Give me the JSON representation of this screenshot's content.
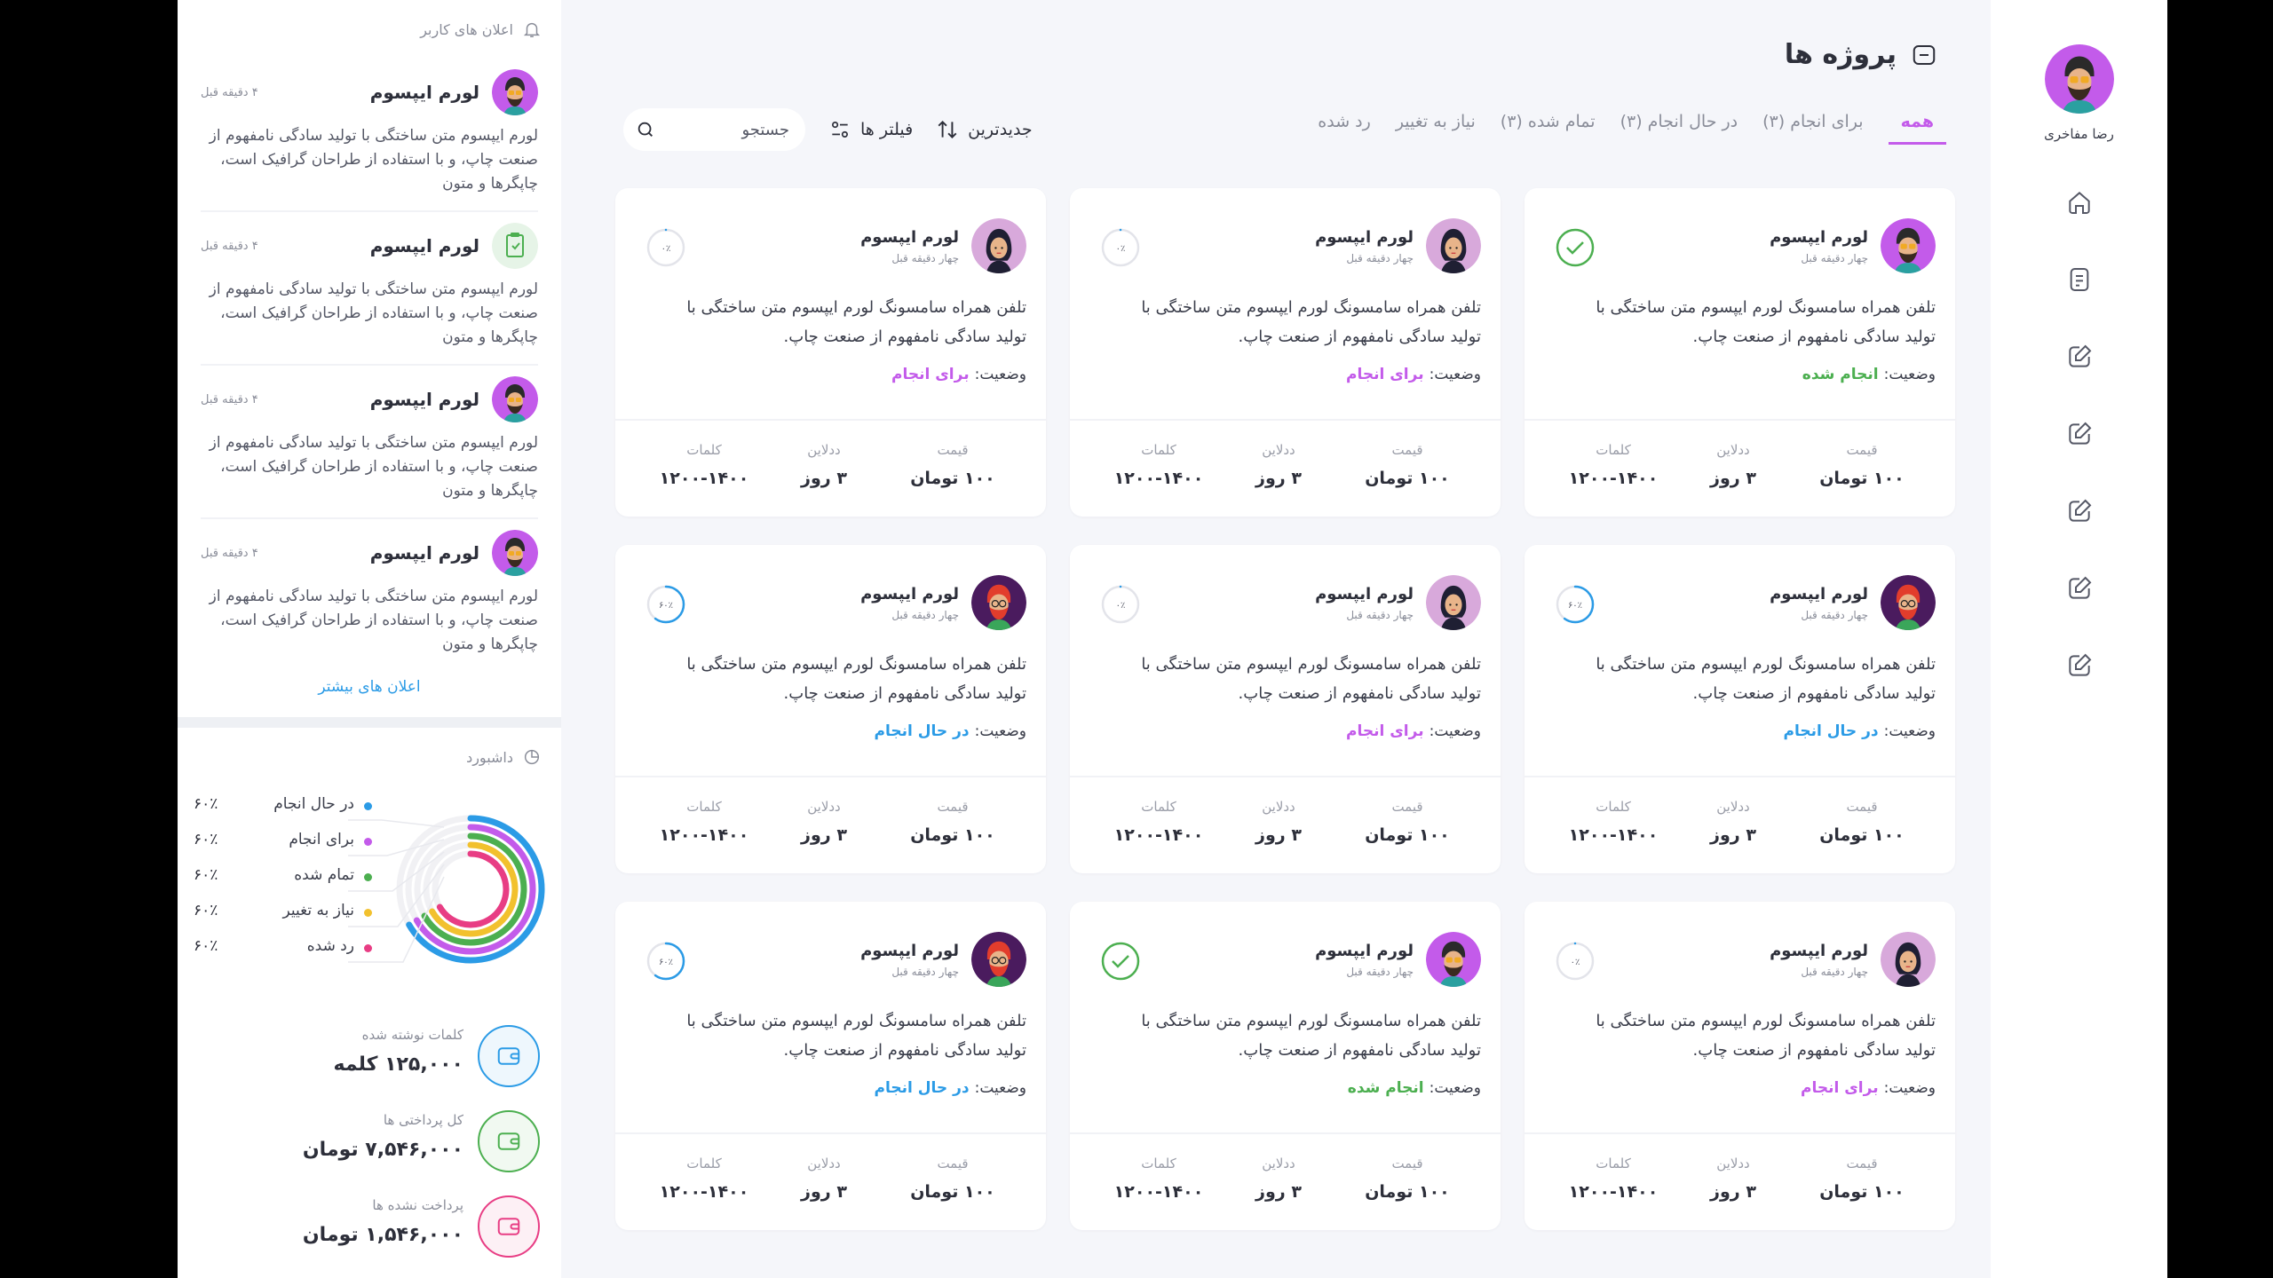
{
  "user": {
    "name": "رضا مفاخری"
  },
  "nav_icons": [
    "home-icon",
    "document-icon",
    "edit-icon",
    "edit-icon",
    "edit-icon",
    "edit-icon",
    "edit-icon"
  ],
  "page": {
    "title": "پروژه ها"
  },
  "tabs": [
    {
      "label": "همه",
      "active": true
    },
    {
      "label": "برای انجام (۳)"
    },
    {
      "label": "در حال انجام (۳)"
    },
    {
      "label": "تمام شده (۳)"
    },
    {
      "label": "نیاز به تغییر"
    },
    {
      "label": "رد شده"
    }
  ],
  "tools": {
    "sort": "جدیدترین",
    "filters": "فیلتر ها",
    "search_placeholder": "جستجو"
  },
  "notifications": {
    "title": "اعلان های کاربر",
    "items": [
      {
        "title": "لورم ایپسوم",
        "time": "۴ دقیقه قبل",
        "text": "لورم ایپسوم متن ساختگی با تولید سادگی نامفهوم از صنعت چاپ، و با استفاده از طراحان گرافیک است، چاپگرها و متون",
        "avatar": "man"
      },
      {
        "title": "لورم ایپسوم",
        "time": "۴ دقیقه قبل",
        "text": "لورم ایپسوم متن ساختگی با تولید سادگی نامفهوم از صنعت چاپ، و با استفاده از طراحان گرافیک است، چاپگرها و متون",
        "avatar": "clipboard"
      },
      {
        "title": "لورم ایپسوم",
        "time": "۴ دقیقه قبل",
        "text": "لورم ایپسوم متن ساختگی با تولید سادگی نامفهوم از صنعت چاپ، و با استفاده از طراحان گرافیک است، چاپگرها و متون",
        "avatar": "man"
      },
      {
        "title": "لورم ایپسوم",
        "time": "۴ دقیقه قبل",
        "text": "لورم ایپسوم متن ساختگی با تولید سادگی نامفهوم از صنعت چاپ، و با استفاده از طراحان گرافیک است، چاپگرها و متون",
        "avatar": "man"
      }
    ],
    "more": "اعلان های بیشتر"
  },
  "dashboard": {
    "title": "داشبورد",
    "legend": [
      {
        "label": "در حال انجام",
        "pct": "۶۰٪",
        "color": "#2b9be6"
      },
      {
        "label": "برای انجام",
        "pct": "۶۰٪",
        "color": "#c35bea"
      },
      {
        "label": "تمام شده",
        "pct": "۶۰٪",
        "color": "#4caf50"
      },
      {
        "label": "نیاز به تغییر",
        "pct": "۶۰٪",
        "color": "#f2c12e"
      },
      {
        "label": "رد شده",
        "pct": "۶۰٪",
        "color": "#e83d84"
      }
    ],
    "stats": [
      {
        "label": "کلمات نوشته شده",
        "value": "۱۲۵,۰۰۰ کلمه",
        "color": "#2b9be6"
      },
      {
        "label": "کل پرداختی ها",
        "value": "۷,۵۴۶,۰۰۰ تومان",
        "color": "#4caf50"
      },
      {
        "label": "پرداخت نشده ها",
        "value": "۱,۵۴۶,۰۰۰ تومان",
        "color": "#e83d84"
      }
    ]
  },
  "card_labels": {
    "status": "وضعیت:",
    "price": "قیمت",
    "deadline": "ددلاین",
    "words": "کلمات"
  },
  "cards": [
    {
      "name": "لورم ایپسوم",
      "time": "چهار دقیقه قبل",
      "text": "تلفن همراه سامسونگ لورم ایپسوم متن ساختگی با تولید سادگی نامفهوم از صنعت چاپ.",
      "status": "انجام شده",
      "status_color": "#4caf50",
      "progress": 1.0,
      "progress_label": "",
      "avatar": "man",
      "price": "۱۰۰ تومان",
      "deadline": "۳ روز",
      "words": "۱۲۰۰-۱۴۰۰"
    },
    {
      "name": "لورم ایپسوم",
      "time": "چهار دقیقه قبل",
      "text": "تلفن همراه سامسونگ لورم ایپسوم متن ساختگی با تولید سادگی نامفهوم از صنعت چاپ.",
      "status": "برای انجام",
      "status_color": "#c35bea",
      "progress": 0,
      "progress_label": "۰٪",
      "avatar": "woman",
      "price": "۱۰۰ تومان",
      "deadline": "۳ روز",
      "words": "۱۲۰۰-۱۴۰۰"
    },
    {
      "name": "لورم ایپسوم",
      "time": "چهار دقیقه قبل",
      "text": "تلفن همراه سامسونگ لورم ایپسوم متن ساختگی با تولید سادگی نامفهوم از صنعت چاپ.",
      "status": "برای انجام",
      "status_color": "#c35bea",
      "progress": 0,
      "progress_label": "۰٪",
      "avatar": "woman",
      "price": "۱۰۰ تومان",
      "deadline": "۳ روز",
      "words": "۱۲۰۰-۱۴۰۰"
    },
    {
      "name": "لورم ایپسوم",
      "time": "چهار دقیقه قبل",
      "text": "تلفن همراه سامسونگ لورم ایپسوم متن ساختگی با تولید سادگی نامفهوم از صنعت چاپ.",
      "status": "در حال انجام",
      "status_color": "#2b9be6",
      "progress": 0.6,
      "progress_label": "۶۰٪",
      "avatar": "redhair",
      "price": "۱۰۰ تومان",
      "deadline": "۳ روز",
      "words": "۱۲۰۰-۱۴۰۰"
    },
    {
      "name": "لورم ایپسوم",
      "time": "چهار دقیقه قبل",
      "text": "تلفن همراه سامسونگ لورم ایپسوم متن ساختگی با تولید سادگی نامفهوم از صنعت چاپ.",
      "status": "برای انجام",
      "status_color": "#c35bea",
      "progress": 0,
      "progress_label": "۰٪",
      "avatar": "woman",
      "price": "۱۰۰ تومان",
      "deadline": "۳ روز",
      "words": "۱۲۰۰-۱۴۰۰"
    },
    {
      "name": "لورم ایپسوم",
      "time": "چهار دقیقه قبل",
      "text": "تلفن همراه سامسونگ لورم ایپسوم متن ساختگی با تولید سادگی نامفهوم از صنعت چاپ.",
      "status": "در حال انجام",
      "status_color": "#2b9be6",
      "progress": 0.6,
      "progress_label": "۶۰٪",
      "avatar": "redhair",
      "price": "۱۰۰ تومان",
      "deadline": "۳ روز",
      "words": "۱۲۰۰-۱۴۰۰"
    },
    {
      "name": "لورم ایپسوم",
      "time": "چهار دقیقه قبل",
      "text": "تلفن همراه سامسونگ لورم ایپسوم متن ساختگی با تولید سادگی نامفهوم از صنعت چاپ.",
      "status": "برای انجام",
      "status_color": "#c35bea",
      "progress": 0,
      "progress_label": "۰٪",
      "avatar": "woman",
      "price": "۱۰۰ تومان",
      "deadline": "۳ روز",
      "words": "۱۲۰۰-۱۴۰۰"
    },
    {
      "name": "لورم ایپسوم",
      "time": "چهار دقیقه قبل",
      "text": "تلفن همراه سامسونگ لورم ایپسوم متن ساختگی با تولید سادگی نامفهوم از صنعت چاپ.",
      "status": "انجام شده",
      "status_color": "#4caf50",
      "progress": 1.0,
      "progress_label": "",
      "avatar": "man",
      "price": "۱۰۰ تومان",
      "deadline": "۳ روز",
      "words": "۱۲۰۰-۱۴۰۰"
    },
    {
      "name": "لورم ایپسوم",
      "time": "چهار دقیقه قبل",
      "text": "تلفن همراه سامسونگ لورم ایپسوم متن ساختگی با تولید سادگی نامفهوم از صنعت چاپ.",
      "status": "در حال انجام",
      "status_color": "#2b9be6",
      "progress": 0.6,
      "progress_label": "۶۰٪",
      "avatar": "redhair",
      "price": "۱۰۰ تومان",
      "deadline": "۳ روز",
      "words": "۱۲۰۰-۱۴۰۰"
    }
  ]
}
